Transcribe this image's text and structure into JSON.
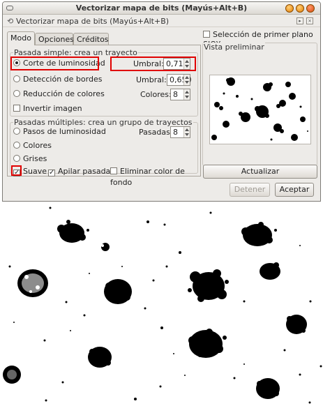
{
  "window": {
    "title": "Vectorizar mapa de bits (Mayús+Alt+B)",
    "dialog_title": "Vectorizar mapa de bits (Mayús+Alt+B)"
  },
  "tabs": [
    {
      "label": "Modo"
    },
    {
      "label": "Opciones"
    },
    {
      "label": "Créditos"
    }
  ],
  "single": {
    "legend": "Pasada simple: crea un trayecto",
    "brightness_label": "Corte de luminosidad",
    "threshold_label": "Umbral:",
    "threshold_value": "0,710",
    "edges_label": "Detección de bordes",
    "edges_threshold_label": "Umbral:",
    "edges_threshold_value": "0,650",
    "colors_label": "Reducción de colores",
    "colors_count_label": "Colores:",
    "colors_count_value": "8",
    "invert_label": "Invertir imagen"
  },
  "multi": {
    "legend": "Pasadas múltiples: crea un grupo de trayectos",
    "steps_label": "Pasos de luminosidad",
    "scans_label": "Pasadas:",
    "scans_value": "8",
    "colors_label": "Colores",
    "grays_label": "Grises",
    "smooth_label": "Suave",
    "stack_label": "Apilar pasadas",
    "remove_bg_label": "Eliminar color de fondo"
  },
  "preview": {
    "siox_label": "Selección de primer plano SIOX",
    "legend": "Vista preliminar",
    "update_button": "Actualizar"
  },
  "footer": {
    "stop_button": "Detener",
    "ok_button": "Aceptar"
  },
  "colors": {
    "highlight": "#e00000",
    "window_bg": "#edebe8"
  }
}
